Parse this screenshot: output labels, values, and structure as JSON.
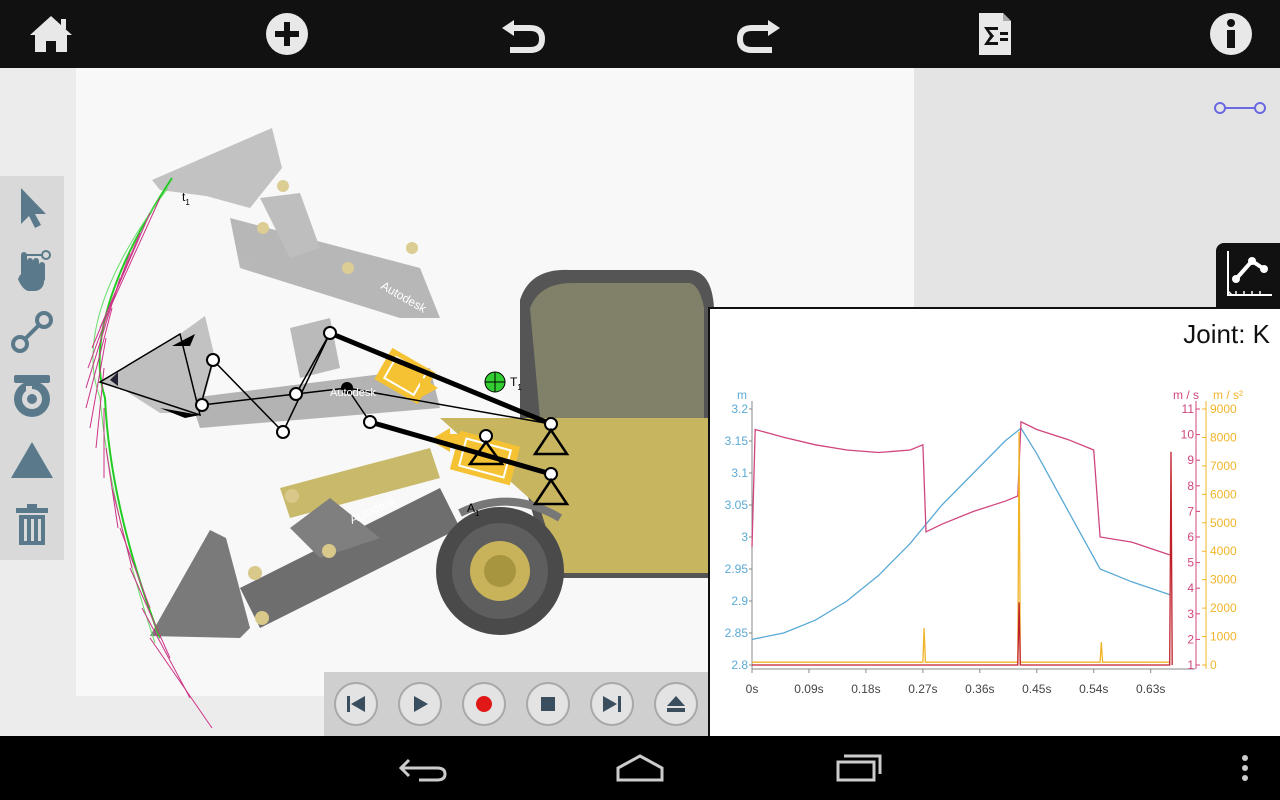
{
  "toolbar": {
    "items": [
      "home-icon",
      "add-icon",
      "undo-icon",
      "redo-icon",
      "equations-icon",
      "info-icon"
    ]
  },
  "tools": {
    "items": [
      "select-icon",
      "drag-icon",
      "link-icon",
      "motor-icon",
      "ground-icon",
      "delete-icon"
    ]
  },
  "canvas": {
    "watermark": "Autodesk",
    "labels": {
      "tracer": "t",
      "tracer_sub": "1",
      "target": "T",
      "target_sub": "1",
      "actuator": "A",
      "actuator_sub": "1"
    }
  },
  "playback": {
    "items": [
      "skip-start-icon",
      "play-icon",
      "record-icon",
      "stop-icon",
      "skip-end-icon",
      "eject-icon"
    ]
  },
  "graph": {
    "title": "Joint: K",
    "unit_left": "m",
    "unit_right_vel": "m / s",
    "unit_right_acc": "m / s²"
  },
  "chart_data": {
    "type": "line",
    "title": "Joint: K",
    "x_ticks": [
      "0s",
      "0.09s",
      "0.18s",
      "0.27s",
      "0.36s",
      "0.45s",
      "0.54s",
      "0.63s"
    ],
    "xlim": [
      0,
      0.7
    ],
    "axes": [
      {
        "unit": "m",
        "side": "left",
        "color": "#5aa9d6",
        "ticks": [
          "2.8",
          "2.85",
          "2.9",
          "2.95",
          "3",
          "3.05",
          "3.1",
          "3.15",
          "3.2"
        ],
        "range": [
          2.8,
          3.2
        ]
      },
      {
        "unit": "m / s",
        "side": "right",
        "color": "#d0457e",
        "ticks": [
          "1",
          "2",
          "3",
          "4",
          "5",
          "6",
          "7",
          "8",
          "9",
          "10",
          "11"
        ],
        "range": [
          1,
          11
        ]
      },
      {
        "unit": "m / s²",
        "side": "right",
        "color": "#f0b429",
        "ticks": [
          "0",
          "1000",
          "2000",
          "3000",
          "4000",
          "5000",
          "6000",
          "7000",
          "8000",
          "9000"
        ],
        "range": [
          0,
          9000
        ]
      }
    ],
    "series": [
      {
        "axis": "m",
        "color": "#5aa9d6",
        "x": [
          0,
          0.05,
          0.1,
          0.15,
          0.2,
          0.25,
          0.3,
          0.35,
          0.4,
          0.425,
          0.45,
          0.5,
          0.55,
          0.6,
          0.66
        ],
        "y": [
          2.84,
          2.85,
          2.87,
          2.9,
          2.94,
          2.99,
          3.05,
          3.1,
          3.15,
          3.17,
          3.13,
          3.04,
          2.95,
          2.93,
          2.91
        ]
      },
      {
        "axis": "m / s",
        "color": "#d0457e",
        "x": [
          0,
          0.005,
          0.05,
          0.1,
          0.15,
          0.2,
          0.25,
          0.27,
          0.275,
          0.3,
          0.35,
          0.4,
          0.42,
          0.425,
          0.45,
          0.5,
          0.54,
          0.55,
          0.6,
          0.66
        ],
        "y": [
          5.6,
          10.2,
          9.9,
          9.6,
          9.4,
          9.3,
          9.4,
          9.6,
          6.2,
          6.5,
          7.0,
          7.4,
          7.6,
          10.5,
          10.2,
          9.8,
          9.4,
          6.0,
          5.8,
          5.3
        ]
      },
      {
        "axis": "m / s²",
        "color": "#f0b429",
        "x": [
          0,
          0.27,
          0.272,
          0.274,
          0.42,
          0.422,
          0.424,
          0.55,
          0.552,
          0.554,
          0.66
        ],
        "y": [
          100,
          100,
          1300,
          100,
          100,
          8200,
          100,
          100,
          800,
          100,
          100
        ]
      },
      {
        "axis": "m / s²",
        "color": "#c0202a",
        "x": [
          0,
          0.42,
          0.422,
          0.424,
          0.66,
          0.662,
          0.664
        ],
        "y": [
          0,
          0,
          2200,
          0,
          0,
          7500,
          0
        ]
      }
    ]
  },
  "navbar": {
    "items": [
      "back-icon",
      "home-nav-icon",
      "recents-icon",
      "overflow-menu-icon"
    ]
  }
}
